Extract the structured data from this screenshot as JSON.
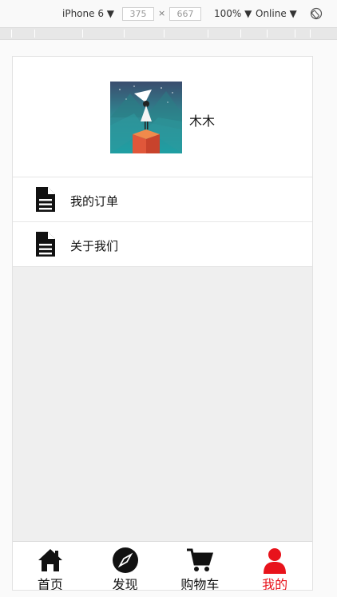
{
  "devtools": {
    "device": "iPhone 6",
    "width": "375",
    "height": "667",
    "zoom": "100%",
    "network": "Online"
  },
  "profile": {
    "username": "木木"
  },
  "menu": [
    {
      "label": "我的订单",
      "icon": "document-icon"
    },
    {
      "label": "关于我们",
      "icon": "document-icon"
    }
  ],
  "tabbar": {
    "items": [
      {
        "label": "首页",
        "icon": "home-icon"
      },
      {
        "label": "发现",
        "icon": "compass-icon"
      },
      {
        "label": "购物车",
        "icon": "cart-icon"
      },
      {
        "label": "我的",
        "icon": "user-icon",
        "active": true
      }
    ],
    "active_color": "#e8131b"
  }
}
